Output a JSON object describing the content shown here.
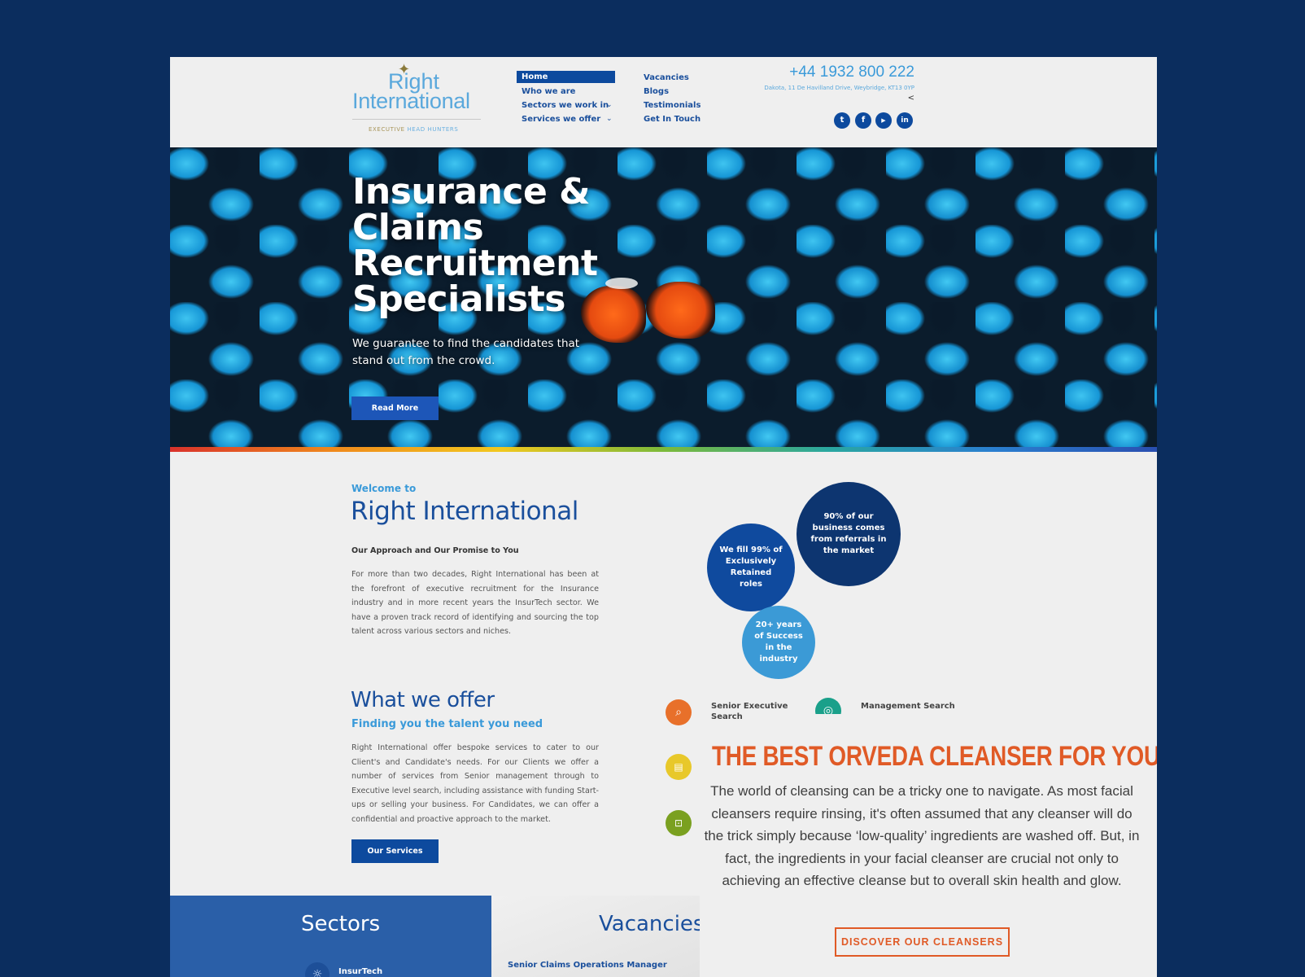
{
  "header": {
    "logo": {
      "line1": "Right",
      "line2": "International",
      "tagline_a": "EXECUTIVE",
      "tagline_b": "HEAD HUNTERS"
    },
    "nav_col1": [
      {
        "label": "Home",
        "active": true
      },
      {
        "label": "Who we are"
      },
      {
        "label": "Sectors we work in",
        "dropdown": true
      },
      {
        "label": "Services we offer",
        "dropdown": true
      }
    ],
    "nav_col2": [
      {
        "label": "Vacancies"
      },
      {
        "label": "Blogs"
      },
      {
        "label": "Testimonials"
      },
      {
        "label": "Get In Touch"
      }
    ],
    "phone": "+44 1932 800 222",
    "address": "Dakota, 11 De Havilland Drive, Weybridge, KT13 0YP",
    "social": [
      {
        "icon": "twitter-icon",
        "glyph": "t"
      },
      {
        "icon": "facebook-icon",
        "glyph": "f"
      },
      {
        "icon": "youtube-icon",
        "glyph": "▶"
      },
      {
        "icon": "linkedin-icon",
        "glyph": "in"
      }
    ]
  },
  "hero": {
    "title_lines": [
      "Insurance &",
      "Claims",
      "Recruitment",
      "Specialists"
    ],
    "subtitle": "We guarantee to find the candidates that stand out from the crowd.",
    "button": "Read More"
  },
  "welcome": {
    "kicker": "Welcome to",
    "title": "Right International",
    "subheading": "Our Approach and Our Promise to You",
    "body": "For more than two decades, Right International has been at the forefront of executive recruitment for the Insurance industry and in more recent years the InsurTech sector. We have a proven track record of identifying and sourcing the top talent across various sectors and niches.",
    "stats": [
      "We fill 99% of Exclusively Retained roles",
      "90% of our business comes from referrals in the market",
      "20+ years of Success in the industry"
    ]
  },
  "offer": {
    "title": "What we offer",
    "subtitle": "Finding you the talent you need",
    "body": "Right International offer bespoke services to cater to our Client's and Candidate's needs. For our Clients we offer a number of services from Senior management through to Executive level search, including assistance with funding Start-ups or selling your business. For Candidates, we can offer a confidential and proactive approach to the market.",
    "button": "Our Services",
    "services": [
      "Senior Executive Search",
      "Management Search"
    ]
  },
  "ad": {
    "headline": "THE BEST ORVEDA CLEANSER FOR YOU?",
    "body": "The world of cleansing can be a tricky one to navigate. As most facial cleansers require rinsing, it's often assumed that any cleanser will do the trick simply because ‘low-quality’ ingredients are washed off. But, in fact, the ingredients in your facial cleanser are crucial not only to achieving an effective cleanse but to overall skin health and glow.",
    "button": "DISCOVER OUR CLEANSERS",
    "color": "#e05a26"
  },
  "sectors": {
    "title": "Sectors",
    "items": [
      "InsurTech"
    ]
  },
  "vacancies": {
    "title": "Vacancies",
    "items": [
      "Senior Claims Operations Manager"
    ]
  },
  "colors": {
    "background": "#0b2d5e",
    "primary": "#0d4a9e",
    "accent": "#3a9ad9"
  }
}
